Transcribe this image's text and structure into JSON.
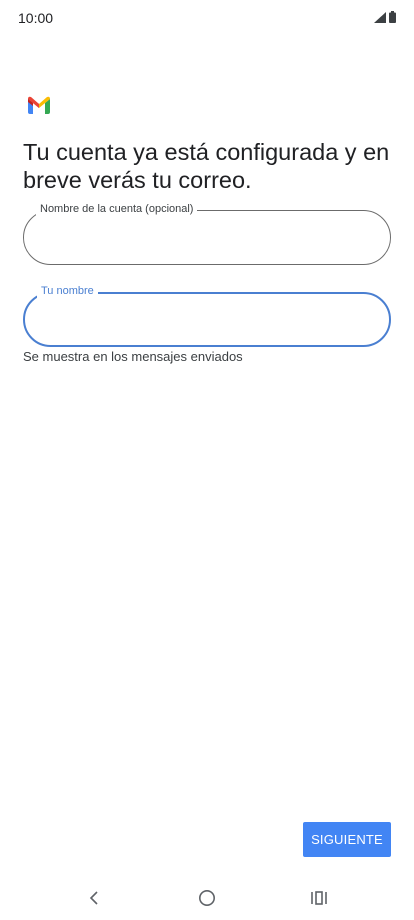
{
  "status_bar": {
    "time": "10:00",
    "icons": [
      "signal-icon",
      "battery-icon"
    ]
  },
  "app": {
    "logo_icon": "gmail-logo-icon",
    "colors": {
      "accent": "#4285f4",
      "focus": "#4a7fd1",
      "text": "#202124"
    }
  },
  "main": {
    "title": "Tu cuenta ya está configurada y en breve verás tu correo.",
    "fields": {
      "account_name": {
        "label": "Nombre de la cuenta (opcional)",
        "value": ""
      },
      "your_name": {
        "label": "Tu nombre",
        "value": "",
        "helper": "Se muestra en los mensajes enviados"
      }
    },
    "next_label": "SIGUIENTE"
  },
  "nav_bar": {
    "icons": [
      "back-icon",
      "home-icon",
      "recents-icon"
    ]
  }
}
